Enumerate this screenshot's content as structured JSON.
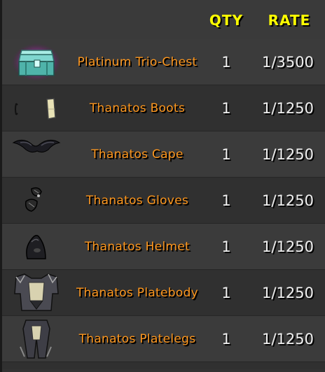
{
  "header": {
    "qty_label": "QTY",
    "rate_label": "RATE"
  },
  "colors": {
    "header_text": "#ffff00",
    "item_name": "#ff981f",
    "values": "#f0f0f0"
  },
  "drops": [
    {
      "name": "Platinum Trio-Chest",
      "qty": "1",
      "rate": "1/3500",
      "icon": "chest-icon"
    },
    {
      "name": "Thanatos Boots",
      "qty": "1",
      "rate": "1/1250",
      "icon": "boots-icon"
    },
    {
      "name": "Thanatos Cape",
      "qty": "1",
      "rate": "1/1250",
      "icon": "cape-icon"
    },
    {
      "name": "Thanatos Gloves",
      "qty": "1",
      "rate": "1/1250",
      "icon": "gloves-icon"
    },
    {
      "name": "Thanatos Helmet",
      "qty": "1",
      "rate": "1/1250",
      "icon": "helmet-icon"
    },
    {
      "name": "Thanatos Platebody",
      "qty": "1",
      "rate": "1/1250",
      "icon": "platebody-icon"
    },
    {
      "name": "Thanatos Platelegs",
      "qty": "1",
      "rate": "1/1250",
      "icon": "platelegs-icon"
    }
  ]
}
